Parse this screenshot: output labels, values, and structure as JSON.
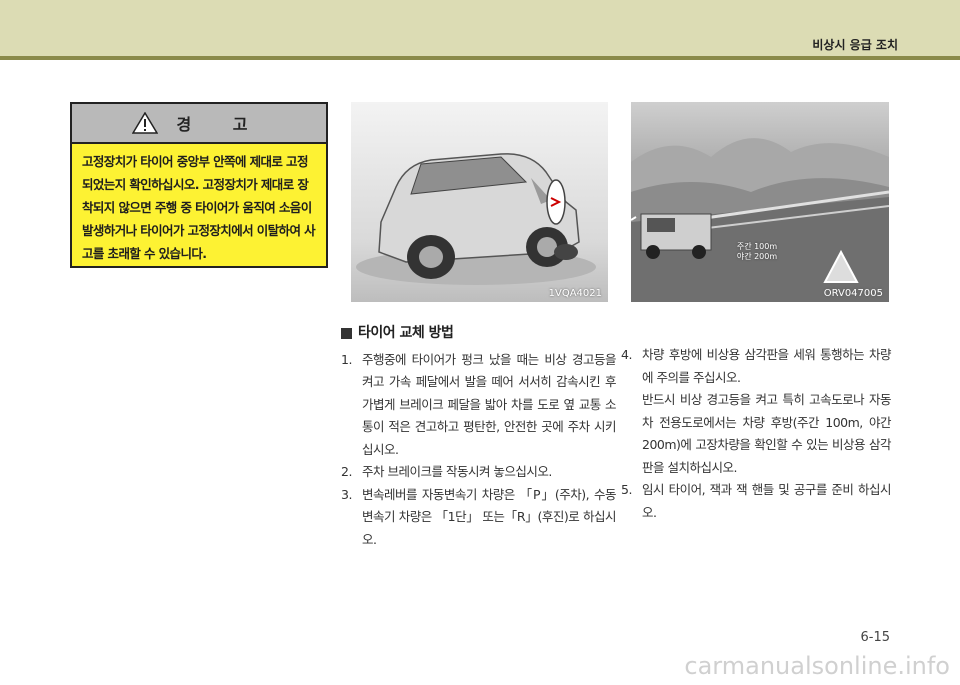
{
  "header": {
    "title": "비상시 응급 조치"
  },
  "warning": {
    "title": "경 고",
    "body": "고정장치가 타이어 중앙부 안쪽에 제대로 고정되었는지 확인하십시오. 고정장치가 제대로 장착되지 않으면 주행 중 타이어가 움직여 소음이 발생하거나 타이어가 고정장치에서 이탈하여 사고를 초래할 수 있습니다."
  },
  "images": [
    {
      "code": "1VQA4021"
    },
    {
      "code": "ORV047005",
      "labels": [
        "주간 100m",
        "야간 200m"
      ]
    }
  ],
  "section": {
    "title": "타이어 교체 방법"
  },
  "steps": [
    {
      "num": "1.",
      "text": "주행중에 타이어가 펑크 났을 때는 비상 경고등을 켜고 가속 페달에서 발을 떼어 서서히 감속시킨 후 가볍게 브레이크 페달을 밟아 차를 도로 옆 교통 소통이 적은 견고하고 평탄한, 안전한 곳에 주차 시키십시오."
    },
    {
      "num": "2.",
      "text": "주차 브레이크를 작동시켜 놓으십시오."
    },
    {
      "num": "3.",
      "text": "변속레버를 자동변속기 차량은 「P」(주차), 수동변속기 차량은 「1단」 또는「R」(후진)로 하십시오."
    },
    {
      "num": "4.",
      "text": "차량 후방에 비상용 삼각판을 세워 통행하는 차량에 주의를 주십시오.",
      "extra": "반드시 비상 경고등을 켜고 특히 고속도로나 자동차 전용도로에서는 차량 후방(주간 100m, 야간 200m)에 고장차량을 확인할 수 있는 비상용 삼각판을 설치하십시오."
    },
    {
      "num": "5.",
      "text": "임시 타이어, 잭과 잭 핸들 및 공구를 준비 하십시오."
    }
  ],
  "page_number": "6-15",
  "watermark": "carmanualsonline.info"
}
